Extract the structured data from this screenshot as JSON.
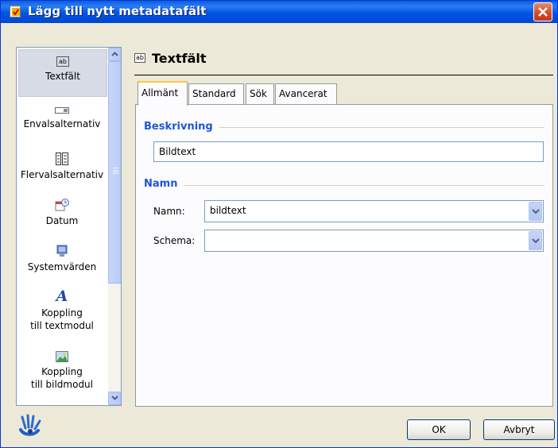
{
  "window": {
    "title": "Lägg till nytt metadatafält"
  },
  "sidebar": {
    "items": [
      {
        "icon": "textfield-icon",
        "label": "Textfält"
      },
      {
        "icon": "single-choice-icon",
        "label": "Envalsalternativ"
      },
      {
        "icon": "multi-choice-icon",
        "label": "Flervalsalternativ"
      },
      {
        "icon": "calendar-icon",
        "label": "Datum"
      },
      {
        "icon": "computer-icon",
        "label": "Systemvärden"
      },
      {
        "icon": "text-module-icon",
        "label_line1": "Koppling",
        "label_line2": "till textmodul"
      },
      {
        "icon": "image-module-icon",
        "label_line1": "Koppling",
        "label_line2": "till bildmodul"
      }
    ]
  },
  "header": {
    "title": "Textfält"
  },
  "tabs": [
    "Allmänt",
    "Standard",
    "Sök",
    "Avancerat"
  ],
  "description_group": {
    "title": "Beskrivning",
    "value": "Bildtext"
  },
  "name_group": {
    "title": "Namn",
    "name_label": "Namn:",
    "name_value": "bildtext",
    "schema_label": "Schema:",
    "schema_value": ""
  },
  "footer": {
    "ok_label": "OK",
    "cancel_label": "Avbryt"
  }
}
